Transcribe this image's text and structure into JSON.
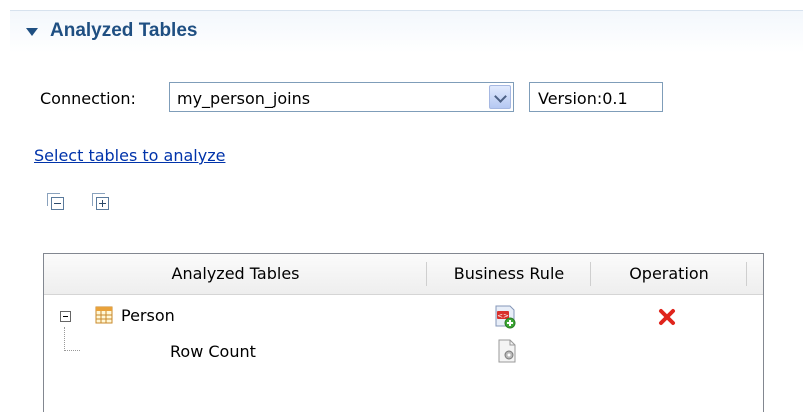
{
  "section": {
    "title": "Analyzed Tables"
  },
  "connection": {
    "label": "Connection:",
    "selected": "my_person_joins",
    "version": "Version:0.1"
  },
  "link": {
    "select_tables": "Select tables to analyze"
  },
  "table": {
    "columns": [
      "Analyzed Tables",
      "Business Rule",
      "Operation"
    ],
    "rows": [
      {
        "name": "Person",
        "business_rule_icon": "add-rule-icon",
        "operation_icon": "delete-icon"
      },
      {
        "name": "Row Count",
        "business_rule_icon": "indicator-settings-icon"
      }
    ]
  },
  "colors": {
    "header_title": "#1f4f82",
    "link": "#0033aa",
    "delete": "#e0241c"
  }
}
